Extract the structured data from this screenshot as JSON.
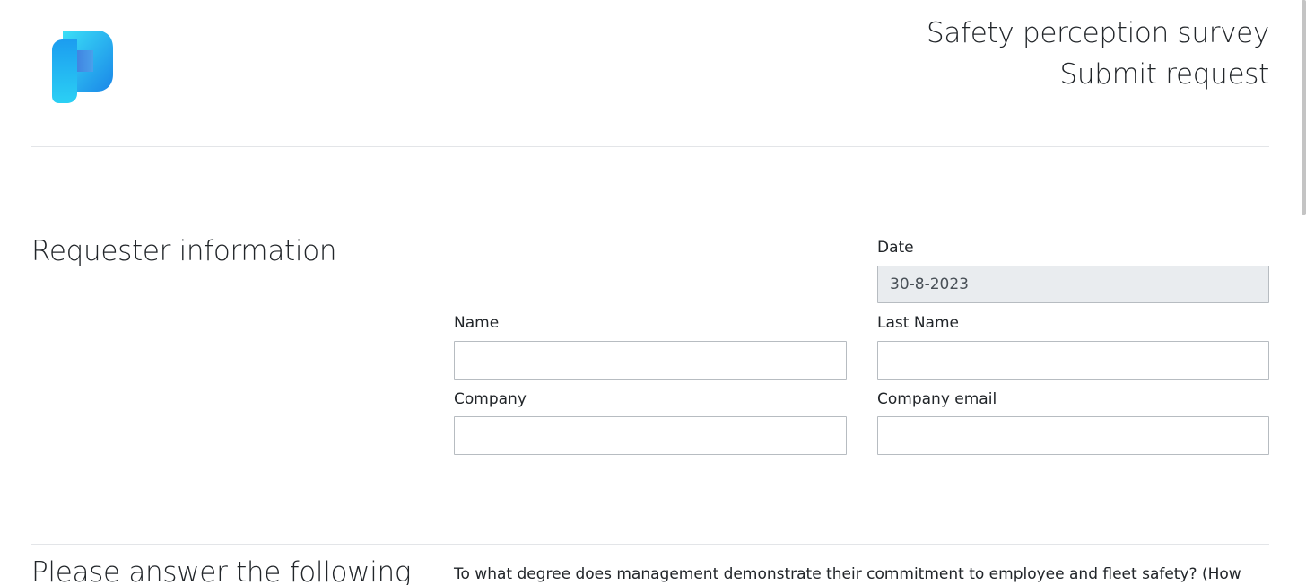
{
  "header": {
    "title": "Safety perception survey",
    "subtitle": "Submit request",
    "logo_icon": "power-pages-logo-icon",
    "logo_colors": [
      "#2bd4f5",
      "#1e6fe0"
    ]
  },
  "requester": {
    "section_title": "Requester information",
    "fields": {
      "date": {
        "label": "Date",
        "value": "30-8-2023"
      },
      "name": {
        "label": "Name",
        "value": ""
      },
      "last_name": {
        "label": "Last Name",
        "value": ""
      },
      "company": {
        "label": "Company",
        "value": ""
      },
      "company_email": {
        "label": "Company email",
        "value": ""
      }
    }
  },
  "questions": {
    "section_title": "Please answer the following",
    "first_question": "To what degree does management demonstrate their commitment to employee and fleet safety? (How"
  },
  "colors": {
    "divider": "#e3e5e8",
    "input_border": "#b7bcc1",
    "readonly_bg": "#e9ecef"
  }
}
